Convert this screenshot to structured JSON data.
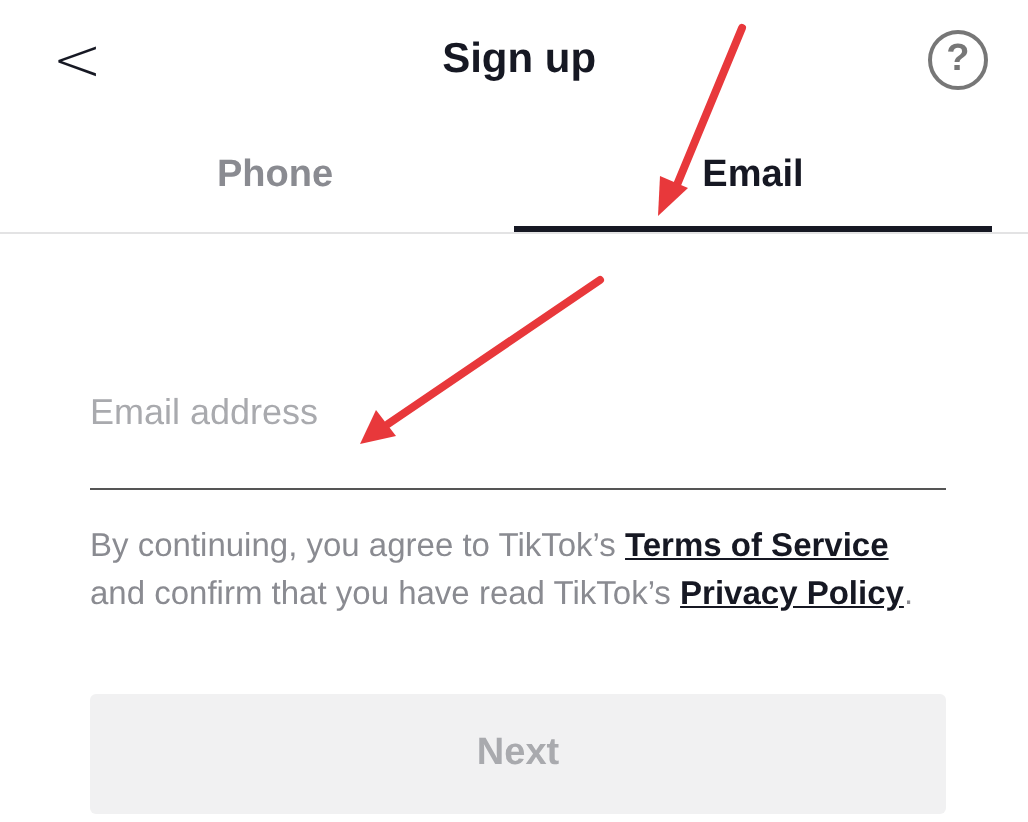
{
  "header": {
    "back": "<",
    "title": "Sign up",
    "help": "?"
  },
  "tabs": [
    {
      "label": "Phone",
      "selected": false
    },
    {
      "label": "Email",
      "selected": true
    }
  ],
  "email_field": {
    "placeholder": "Email address"
  },
  "consent": [
    {
      "kind": "text",
      "text": "By continuing, you agree to TikTok’s "
    },
    {
      "kind": "link",
      "text": "Terms of Service"
    },
    {
      "kind": "text",
      "text": " and confirm that you have read TikTok’s "
    },
    {
      "kind": "link",
      "text": "Privacy Policy"
    },
    {
      "kind": "text",
      "text": "."
    }
  ],
  "next_button": {
    "label": "Next",
    "disabled": true
  },
  "annotations": [
    {
      "kind": "arrow"
    },
    {
      "kind": "arrow"
    }
  ]
}
